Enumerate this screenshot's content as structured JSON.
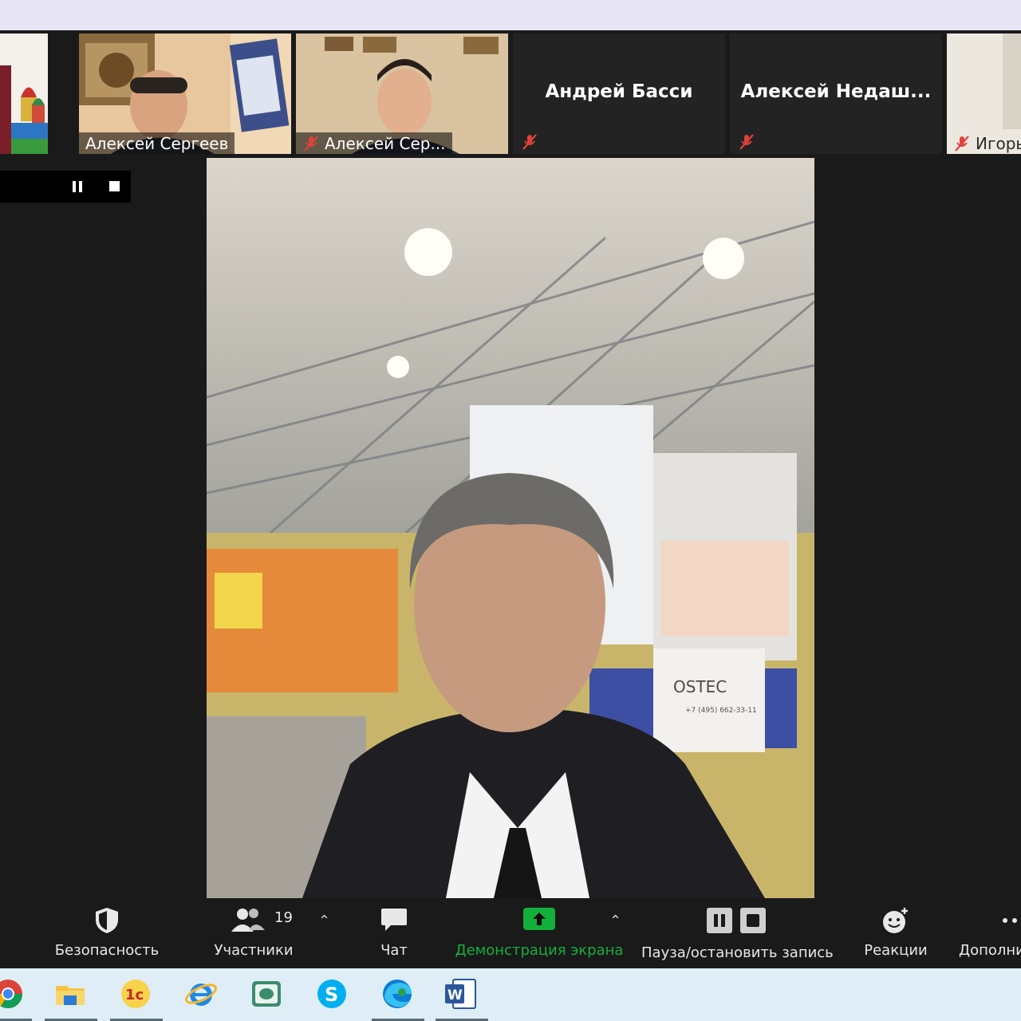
{
  "gallery": {
    "tiles": [
      {
        "name": ""
      },
      {
        "name": "Алексей Сергеев"
      },
      {
        "name": "Алексей Сер..."
      },
      {
        "name": "Андрей Басси"
      },
      {
        "name": "Алексей  Недаш..."
      },
      {
        "name": "Игорь"
      }
    ]
  },
  "main_video": {
    "booth_logo": "OSTEC",
    "booth_phone": "+7 (495) 662-33-11"
  },
  "toolbar": {
    "security_label": "Безопасность",
    "participants_label": "Участники",
    "participants_count": "19",
    "chat_label": "Чат",
    "share_label": "Демонстрация экрана",
    "record_label": "Пауза/остановить запись",
    "reactions_label": "Реакции",
    "more_label": "Дополни"
  },
  "colors": {
    "share_green": "#12b03b",
    "muted_red": "#e0413a",
    "top_strip": "#e7e4f6",
    "taskbar": "#dfeef6"
  },
  "taskbar_icons": [
    "chrome-icon",
    "file-explorer-icon",
    "1c-icon",
    "internet-explorer-icon",
    "screenshot-tool-icon",
    "skype-icon",
    "edge-icon",
    "word-icon"
  ]
}
